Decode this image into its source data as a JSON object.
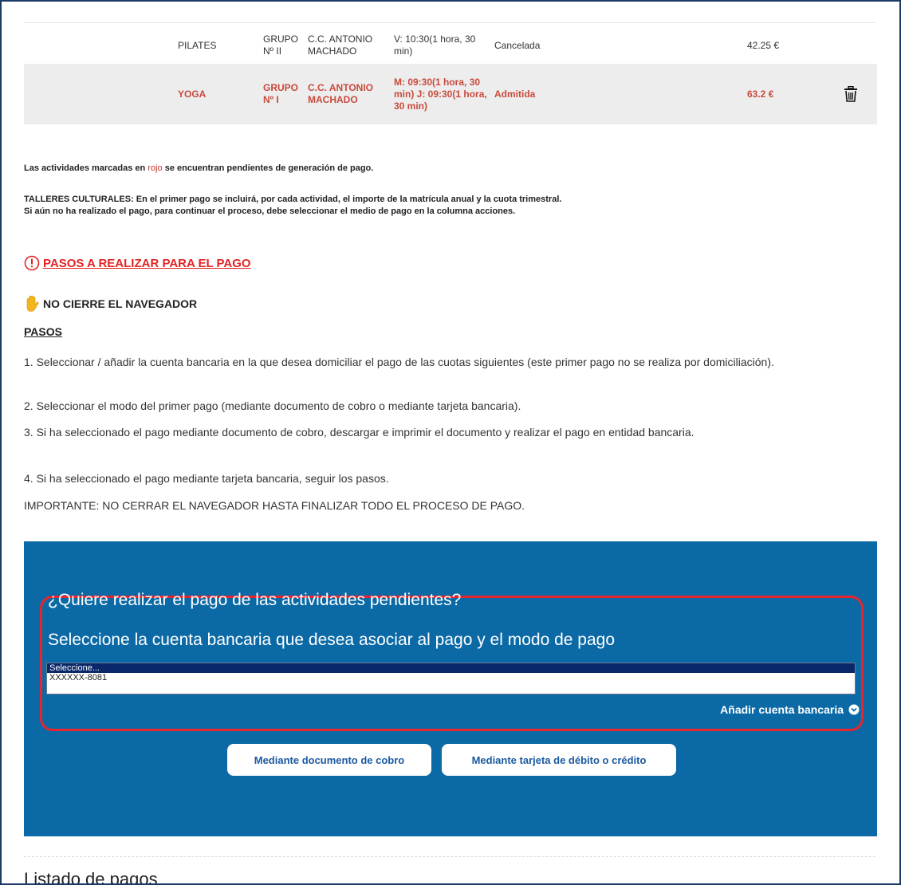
{
  "activities": [
    {
      "activity": "PILATES",
      "group": "GRUPO Nº II",
      "center": "C.C. ANTONIO MACHADO",
      "schedule": "V: 10:30(1 hora, 30 min)",
      "status": "Cancelada",
      "price": "42.25 €"
    },
    {
      "activity": "YOGA",
      "group": "GRUPO Nº I",
      "center": "C.C. ANTONIO MACHADO",
      "schedule": "M: 09:30(1 hora, 30 min) J: 09:30(1 hora, 30 min)",
      "status": "Admitida",
      "price": "63.2 €"
    }
  ],
  "notes": {
    "pending_pre": "Las actividades marcadas en ",
    "pending_red": "rojo",
    "pending_post": " se encuentran pendientes de generación de pago.",
    "talleres_1": "TALLERES CULTURALES: En el primer pago se incluirá, por cada actividad, el importe de la matrícula anual y la cuota trimestral.",
    "talleres_2": "Si aún no ha realizado el pago, para continuar el proceso, debe seleccionar el medio de pago en la columna acciones."
  },
  "pasos_heading": "PASOS A REALIZAR PARA EL PAGO",
  "warning": "NO CIERRE EL NAVEGADOR",
  "pasos_label": "PASOS",
  "steps": [
    "1. Seleccionar / añadir la cuenta bancaria en la que desea domiciliar el pago de las cuotas siguientes (este primer pago no se realiza por domiciliación).",
    "2. Seleccionar el modo del primer pago (mediante documento de cobro o mediante tarjeta bancaria).",
    "3. Si ha seleccionado el pago mediante documento de cobro, descargar e imprimir el documento y realizar el pago en entidad bancaria.",
    "4. Si ha seleccionado el pago mediante tarjeta bancaria, seguir los pasos.",
    "IMPORTANTE: NO CERRAR EL NAVEGADOR HASTA FINALIZAR TODO EL PROCESO DE PAGO."
  ],
  "payment": {
    "question": "¿Quiere realizar el pago de las actividades pendientes?",
    "instruction": "Seleccione la cuenta bancaria que desea asociar al pago y el modo de pago",
    "options": [
      "Seleccione...",
      "XXXXXX-8081"
    ],
    "add_account": "Añadir cuenta bancaria",
    "btn_documento": "Mediante documento de cobro",
    "btn_tarjeta": "Mediante tarjeta de débito o crédito"
  },
  "listado_title": "Listado de pagos",
  "colors": {
    "pending_red": "#c94a3c",
    "panel_blue": "#0b6aa6",
    "highlight_red": "#e8242e"
  }
}
